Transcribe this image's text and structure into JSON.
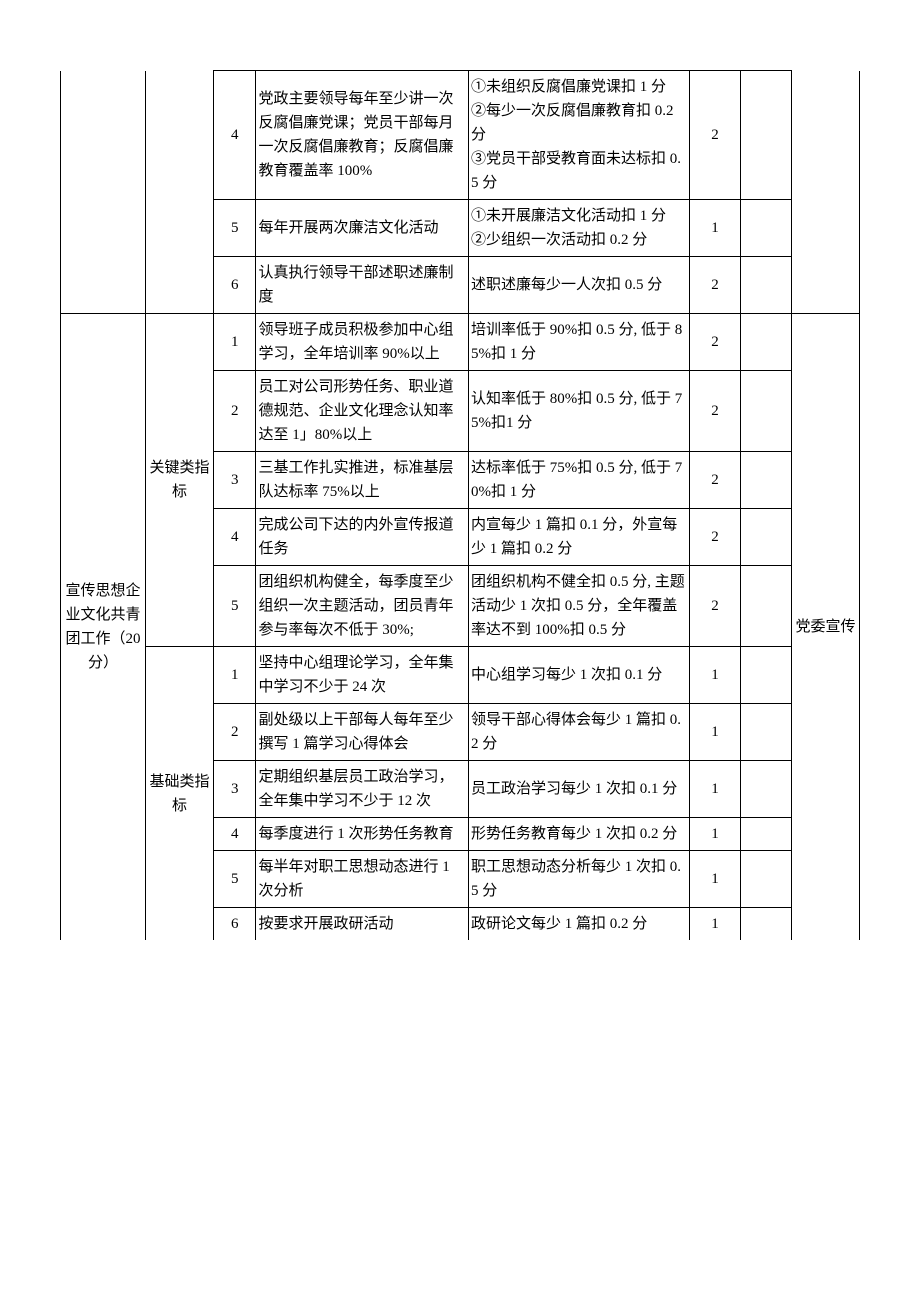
{
  "sectionA": {
    "rows": [
      {
        "num": "4",
        "content": "党政主要领导每年至少讲一次反腐倡廉党课；党员干部每月一次反腐倡廉教育；反腐倡廉教育覆盖率 100%",
        "criteria": "①未组织反腐倡廉党课扣 1 分\n②每少一次反腐倡廉教育扣 0.2 分\n③党员干部受教育面未达标扣 0.5 分",
        "score": "2"
      },
      {
        "num": "5",
        "content": "每年开展两次廉洁文化活动",
        "criteria": "①未开展廉洁文化活动扣 1 分\n②少组织一次活动扣 0.2 分",
        "score": "1"
      },
      {
        "num": "6",
        "content": "认真执行领导干部述职述廉制度",
        "criteria": "述职述廉每少一人次扣 0.5 分",
        "score": "2"
      }
    ]
  },
  "sectionB": {
    "title": "宣传思想企业文化共青团工作（20 分）",
    "dept": "党委宣传",
    "key": {
      "label": "关键类指标",
      "rows": [
        {
          "num": "1",
          "content": "领导班子成员积极参加中心组学习，全年培训率 90%以上",
          "criteria": "培训率低于 90%扣 0.5 分, 低于 85%扣 1 分",
          "score": "2"
        },
        {
          "num": "2",
          "content": "员工对公司形势任务、职业道德规范、企业文化理念认知率达至 1」80%以上",
          "criteria": "认知率低于 80%扣 0.5 分, 低于 75%扣1 分",
          "score": "2"
        },
        {
          "num": "3",
          "content": "三基工作扎实推进，标准基层队达标率 75%以上",
          "criteria": "达标率低于 75%扣 0.5 分, 低于 70%扣 1 分",
          "score": "2"
        },
        {
          "num": "4",
          "content": "完成公司下达的内外宣传报道任务",
          "criteria": "内宣每少 1 篇扣 0.1 分，外宣每少 1 篇扣 0.2 分",
          "score": "2"
        },
        {
          "num": "5",
          "content": "团组织机构健全，每季度至少组织一次主题活动，团员青年参与率每次不低于 30%;",
          "criteria": "团组织机构不健全扣 0.5 分, 主题活动少 1 次扣 0.5 分，全年覆盖率达不到 100%扣 0.5 分",
          "score": "2"
        }
      ]
    },
    "base": {
      "label": "基础类指标",
      "rows": [
        {
          "num": "1",
          "content": "坚持中心组理论学习，全年集中学习不少于 24 次",
          "criteria": "中心组学习每少 1 次扣 0.1 分",
          "score": "1"
        },
        {
          "num": "2",
          "content": "副处级以上干部每人每年至少撰写 1 篇学习心得体会",
          "criteria": "领导干部心得体会每少 1 篇扣 0.2 分",
          "score": "1"
        },
        {
          "num": "3",
          "content": "定期组织基层员工政治学习，全年集中学习不少于 12 次",
          "criteria": "员工政治学习每少 1 次扣 0.1 分",
          "score": "1"
        },
        {
          "num": "4",
          "content": "每季度进行 1 次形势任务教育",
          "criteria": "形势任务教育每少 1 次扣 0.2 分",
          "score": "1"
        },
        {
          "num": "5",
          "content": "每半年对职工思想动态进行 1 次分析",
          "criteria": "职工思想动态分析每少 1 次扣 0.5 分",
          "score": "1"
        },
        {
          "num": "6",
          "content": "按要求开展政研活动",
          "criteria": "政研论文每少 1 篇扣 0.2 分",
          "score": "1"
        }
      ]
    }
  }
}
